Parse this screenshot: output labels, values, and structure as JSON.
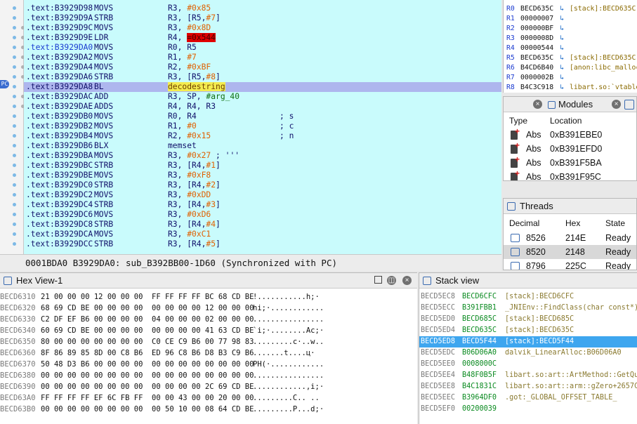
{
  "disasm": {
    "lines": [
      {
        "addr": ".text:B3929D98",
        "mn": "MOVS",
        "op": "R3, #0x85"
      },
      {
        "addr": ".text:B3929D9A",
        "mn": "STRB",
        "op": "R3, [R5,#7]"
      },
      {
        "addr": ".text:B3929D9C",
        "mn": "MOVS",
        "op": "R3, #0x8D"
      },
      {
        "addr": ".text:B3929D9E",
        "mn": "LDR",
        "op": "R4, =0x544"
      },
      {
        "addr": ".text:B3929DA0",
        "mn": "MOVS",
        "op": "R0, R5"
      },
      {
        "addr": ".text:B3929DA2",
        "mn": "MOVS",
        "op": "R1, #7"
      },
      {
        "addr": ".text:B3929DA4",
        "mn": "MOVS",
        "op": "R2, #0xBF"
      },
      {
        "addr": ".text:B3929DA6",
        "mn": "STRB",
        "op": "R3, [R5,#8]"
      },
      {
        "addr": ".text:B3929DA8",
        "mn": "BL",
        "op": "decodestring"
      },
      {
        "addr": ".text:B3929DAC",
        "mn": "ADD",
        "op": "R3, SP, #arg_40"
      },
      {
        "addr": ".text:B3929DAE",
        "mn": "ADDS",
        "op": "R4, R4, R3"
      },
      {
        "addr": ".text:B3929DB0",
        "mn": "MOVS",
        "op": "R0, R4",
        "cm": "; s"
      },
      {
        "addr": ".text:B3929DB2",
        "mn": "MOVS",
        "op": "R1, #0",
        "cm": "; c"
      },
      {
        "addr": ".text:B3929DB4",
        "mn": "MOVS",
        "op": "R2, #0x15",
        "cm": "; n"
      },
      {
        "addr": ".text:B3929DB6",
        "mn": "BLX",
        "op": "memset"
      },
      {
        "addr": ".text:B3929DBA",
        "mn": "MOVS",
        "op": "R3, #0x27 ; '''"
      },
      {
        "addr": ".text:B3929DBC",
        "mn": "STRB",
        "op": "R3, [R4,#1]"
      },
      {
        "addr": ".text:B3929DBE",
        "mn": "MOVS",
        "op": "R3, #0xF8"
      },
      {
        "addr": ".text:B3929DC0",
        "mn": "STRB",
        "op": "R3, [R4,#2]"
      },
      {
        "addr": ".text:B3929DC2",
        "mn": "MOVS",
        "op": "R3, #0xDD"
      },
      {
        "addr": ".text:B3929DC4",
        "mn": "STRB",
        "op": "R3, [R4,#3]"
      },
      {
        "addr": ".text:B3929DC6",
        "mn": "MOVS",
        "op": "R3, #0xD6"
      },
      {
        "addr": ".text:B3929DC8",
        "mn": "STRB",
        "op": "R3, [R4,#4]"
      },
      {
        "addr": ".text:B3929DCA",
        "mn": "MOVS",
        "op": "R3, #0xC1"
      },
      {
        "addr": ".text:B3929DCC",
        "mn": "STRB",
        "op": "R3, [R4,#5]"
      }
    ],
    "status": "0001BDA0 B3929DA0: sub_B392BB00-1D60 (Synchronized with PC)",
    "pc_label": "PC"
  },
  "registers": [
    {
      "name": "R0",
      "value": "BECD635C",
      "arrow": "↳",
      "comment": "[stack]:BECD635C"
    },
    {
      "name": "R1",
      "value": "00000007",
      "arrow": "↳",
      "comment": ""
    },
    {
      "name": "R2",
      "value": "000000BF",
      "arrow": "↳",
      "comment": ""
    },
    {
      "name": "R3",
      "value": "0000008D",
      "arrow": "↳",
      "comment": ""
    },
    {
      "name": "R4",
      "value": "00000544",
      "arrow": "↳",
      "comment": ""
    },
    {
      "name": "R5",
      "value": "BECD635C",
      "arrow": "↳",
      "comment": "[stack]:BECD635C"
    },
    {
      "name": "R6",
      "value": "B4CD6B40",
      "arrow": "↳",
      "comment": "[anon:libc_malloc]"
    },
    {
      "name": "R7",
      "value": "0000002B",
      "arrow": "↳",
      "comment": ""
    },
    {
      "name": "R8",
      "value": "B4C3C918",
      "arrow": "↳",
      "comment": "libart.so:`vtable"
    }
  ],
  "modules": {
    "title": "Modules",
    "columns": [
      "Type",
      "Location"
    ],
    "rows": [
      {
        "type": "Abs",
        "location": "0xB391EBE0"
      },
      {
        "type": "Abs",
        "location": "0xB391EFD0"
      },
      {
        "type": "Abs",
        "location": "0xB391F5BA"
      },
      {
        "type": "Abs",
        "location": "0xB391F95C"
      }
    ]
  },
  "threads": {
    "title": "Threads",
    "columns": [
      "Decimal",
      "Hex",
      "State"
    ],
    "rows": [
      {
        "decimal": "8526",
        "hex": "214E",
        "state": "Ready"
      },
      {
        "decimal": "8520",
        "hex": "2148",
        "state": "Ready"
      },
      {
        "decimal": "8796",
        "hex": "225C",
        "state": "Ready"
      }
    ]
  },
  "hexview": {
    "title": "Hex View-1",
    "lines": [
      {
        "addr": "BECD6310",
        "bytes": "21 00 00 00 12 00 00 00  FF FF FF FF BC 68 CD BE",
        "ascii": "!...........h;·"
      },
      {
        "addr": "BECD6320",
        "bytes": "68 69 CD BE 00 00 00 00  00 00 00 00 12 00 00 00",
        "ascii": "hi;·............"
      },
      {
        "addr": "BECD6330",
        "bytes": "C2 DF EF B6 00 00 00 00  04 00 00 00 02 00 00 00",
        "ascii": "................"
      },
      {
        "addr": "BECD6340",
        "bytes": "60 69 CD BE 00 00 00 00  00 00 00 00 41 63 CD BE",
        "ascii": "`i;·........Ac;·"
      },
      {
        "addr": "BECD6350",
        "bytes": "80 00 00 00 00 00 00 00  C0 CE C9 B6 00 77 98 83",
        "ascii": ".........c·..w.."
      },
      {
        "addr": "BECD6360",
        "bytes": "8F 86 89 85 8D 00 C8 B6  ED 96 C8 B6 D8 B3 C9 B6",
        "ascii": ".......t....ц·"
      },
      {
        "addr": "BECD6370",
        "bytes": "50 48 D3 B6 00 00 00 00  00 00 00 00 00 00 00 00",
        "ascii": "PH(·............"
      },
      {
        "addr": "BECD6380",
        "bytes": "00 00 00 00 00 00 00 00  00 00 00 00 00 00 00 00",
        "ascii": "................"
      },
      {
        "addr": "BECD6390",
        "bytes": "00 00 00 00 00 00 00 00  00 00 00 00 2C 69 CD BE",
        "ascii": "............,i;·"
      },
      {
        "addr": "BECD63A0",
        "bytes": "FF FF FF FF EF 6C FB FF  00 00 43 00 00 20 00 00",
        "ascii": ".........C.. .."
      },
      {
        "addr": "BECD63B0",
        "bytes": "00 00 00 00 00 00 00 00  00 50 10 00 08 64 CD BE",
        "ascii": ".........P...d;·"
      }
    ]
  },
  "stackview": {
    "title": "Stack view",
    "selected": 4,
    "lines": [
      {
        "addr": "BECD5EC8",
        "value": "BECD6CFC",
        "comment": "[stack]:BECD6CFC"
      },
      {
        "addr": "BECD5ECC",
        "value": "B391FBB1",
        "comment": "_JNIEnv::FindClass(char const*)+"
      },
      {
        "addr": "BECD5ED0",
        "value": "BECD685C",
        "comment": "[stack]:BECD685C"
      },
      {
        "addr": "BECD5ED4",
        "value": "BECD635C",
        "comment": "[stack]:BECD635C"
      },
      {
        "addr": "BECD5ED8",
        "value": "BECD5F44",
        "comment": "[stack]:BECD5F44"
      },
      {
        "addr": "BECD5EDC",
        "value": "B06D06A0",
        "comment": "dalvik_LinearAlloc:B06D06A0"
      },
      {
        "addr": "BECD5EE0",
        "value": "0008000C",
        "comment": ""
      },
      {
        "addr": "BECD5EE4",
        "value": "B48F0B5F",
        "comment": "libart.so:art::ArtMethod::GetQuic"
      },
      {
        "addr": "BECD5EE8",
        "value": "B4C1831C",
        "comment": "libart.so:art::arm::gZero+2657C"
      },
      {
        "addr": "BECD5EEC",
        "value": "B3964DF0",
        "comment": ".got:_GLOBAL_OFFSET_TABLE_"
      },
      {
        "addr": "BECD5EF0",
        "value": "00200039",
        "comment": ""
      }
    ]
  },
  "colors": {
    "disasm_bg": "#c9fbfc",
    "highlight": "#aeb6ee",
    "stack_selected": "#3ea6ef"
  }
}
